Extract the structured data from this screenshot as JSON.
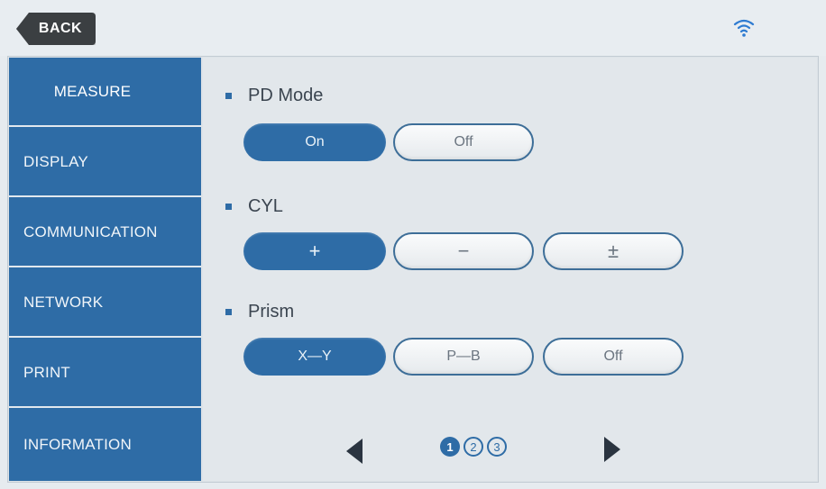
{
  "header": {
    "back_label": "BACK",
    "wifi_icon": "wifi-icon"
  },
  "sidebar": {
    "items": [
      {
        "label": "MEASURE",
        "active": true
      },
      {
        "label": "DISPLAY",
        "active": false
      },
      {
        "label": "COMMUNICATION",
        "active": false
      },
      {
        "label": "NETWORK",
        "active": false
      },
      {
        "label": "PRINT",
        "active": false
      },
      {
        "label": "INFORMATION",
        "active": false
      }
    ]
  },
  "settings": {
    "pd_mode": {
      "label": "PD Mode",
      "options": [
        "On",
        "Off"
      ],
      "selected": "On"
    },
    "cyl": {
      "label": "CYL",
      "options": [
        "+",
        "−",
        "±"
      ],
      "selected": "+"
    },
    "prism": {
      "label": "Prism",
      "options": [
        "X—Y",
        "P—B",
        "Off"
      ],
      "selected": "X—Y"
    }
  },
  "pagination": {
    "pages": [
      "1",
      "2",
      "3"
    ],
    "current": "1"
  },
  "colors": {
    "accent": "#2e6ca6",
    "background": "#e2e7eb",
    "back_button": "#3b3f42"
  }
}
